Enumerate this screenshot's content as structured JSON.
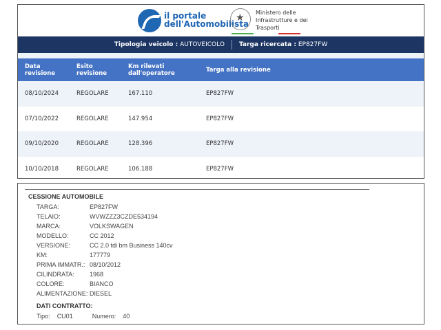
{
  "header": {
    "logo_line1": "il portale",
    "logo_line2": "dell'Automobilista",
    "ministry": [
      "Ministero delle",
      "Infrastrutture e dei",
      "Trasporti"
    ]
  },
  "navbar": {
    "tipologia_label": "Tipologia veicolo :",
    "tipologia_value": "AUTOVEICOLO",
    "targa_label": "Targa ricercata :",
    "targa_value": "EP827FW"
  },
  "table": {
    "columns": [
      "Data revisione",
      "Esito revisione",
      "Km rilevati dall'operatore",
      "Targa alla revisione"
    ],
    "rows": [
      [
        "08/10/2024",
        "REGOLARE",
        "167.110",
        "EP827FW"
      ],
      [
        "07/10/2022",
        "REGOLARE",
        "147.954",
        "EP827FW"
      ],
      [
        "09/10/2020",
        "REGOLARE",
        "128.396",
        "EP827FW"
      ],
      [
        "10/10/2018",
        "REGOLARE",
        "106.188",
        "EP827FW"
      ]
    ]
  },
  "document": {
    "title": "CESSIONE AUTOMOBILE",
    "fields": [
      [
        "TARGA:",
        "EP827FW"
      ],
      [
        "TELAIO:",
        "WVWZZZ3CZDE534194"
      ],
      [
        "MARCA:",
        "VOLKSWAGEN"
      ],
      [
        "MODELLO:",
        "CC 2012"
      ],
      [
        "VERSIONE:",
        "CC 2.0 tdi bm Business 140cv"
      ],
      [
        "KM:",
        "177779"
      ],
      [
        "PRIMA IMMATR.:",
        "08/10/2012"
      ],
      [
        "CILINDRATA:",
        "1968"
      ],
      [
        "COLORE:",
        "BIANCO"
      ],
      [
        "ALIMENTAZIONE:",
        "DIESEL"
      ]
    ],
    "contract_title": "DATI CONTRATTO:",
    "tipo_label": "Tipo:",
    "tipo_value": "CU01",
    "numero_label": "Numero:",
    "numero_value": "40"
  },
  "colors": {
    "navy": "#1d3563",
    "header_blue": "#4472c4",
    "brand_blue": "#1f66b3"
  }
}
